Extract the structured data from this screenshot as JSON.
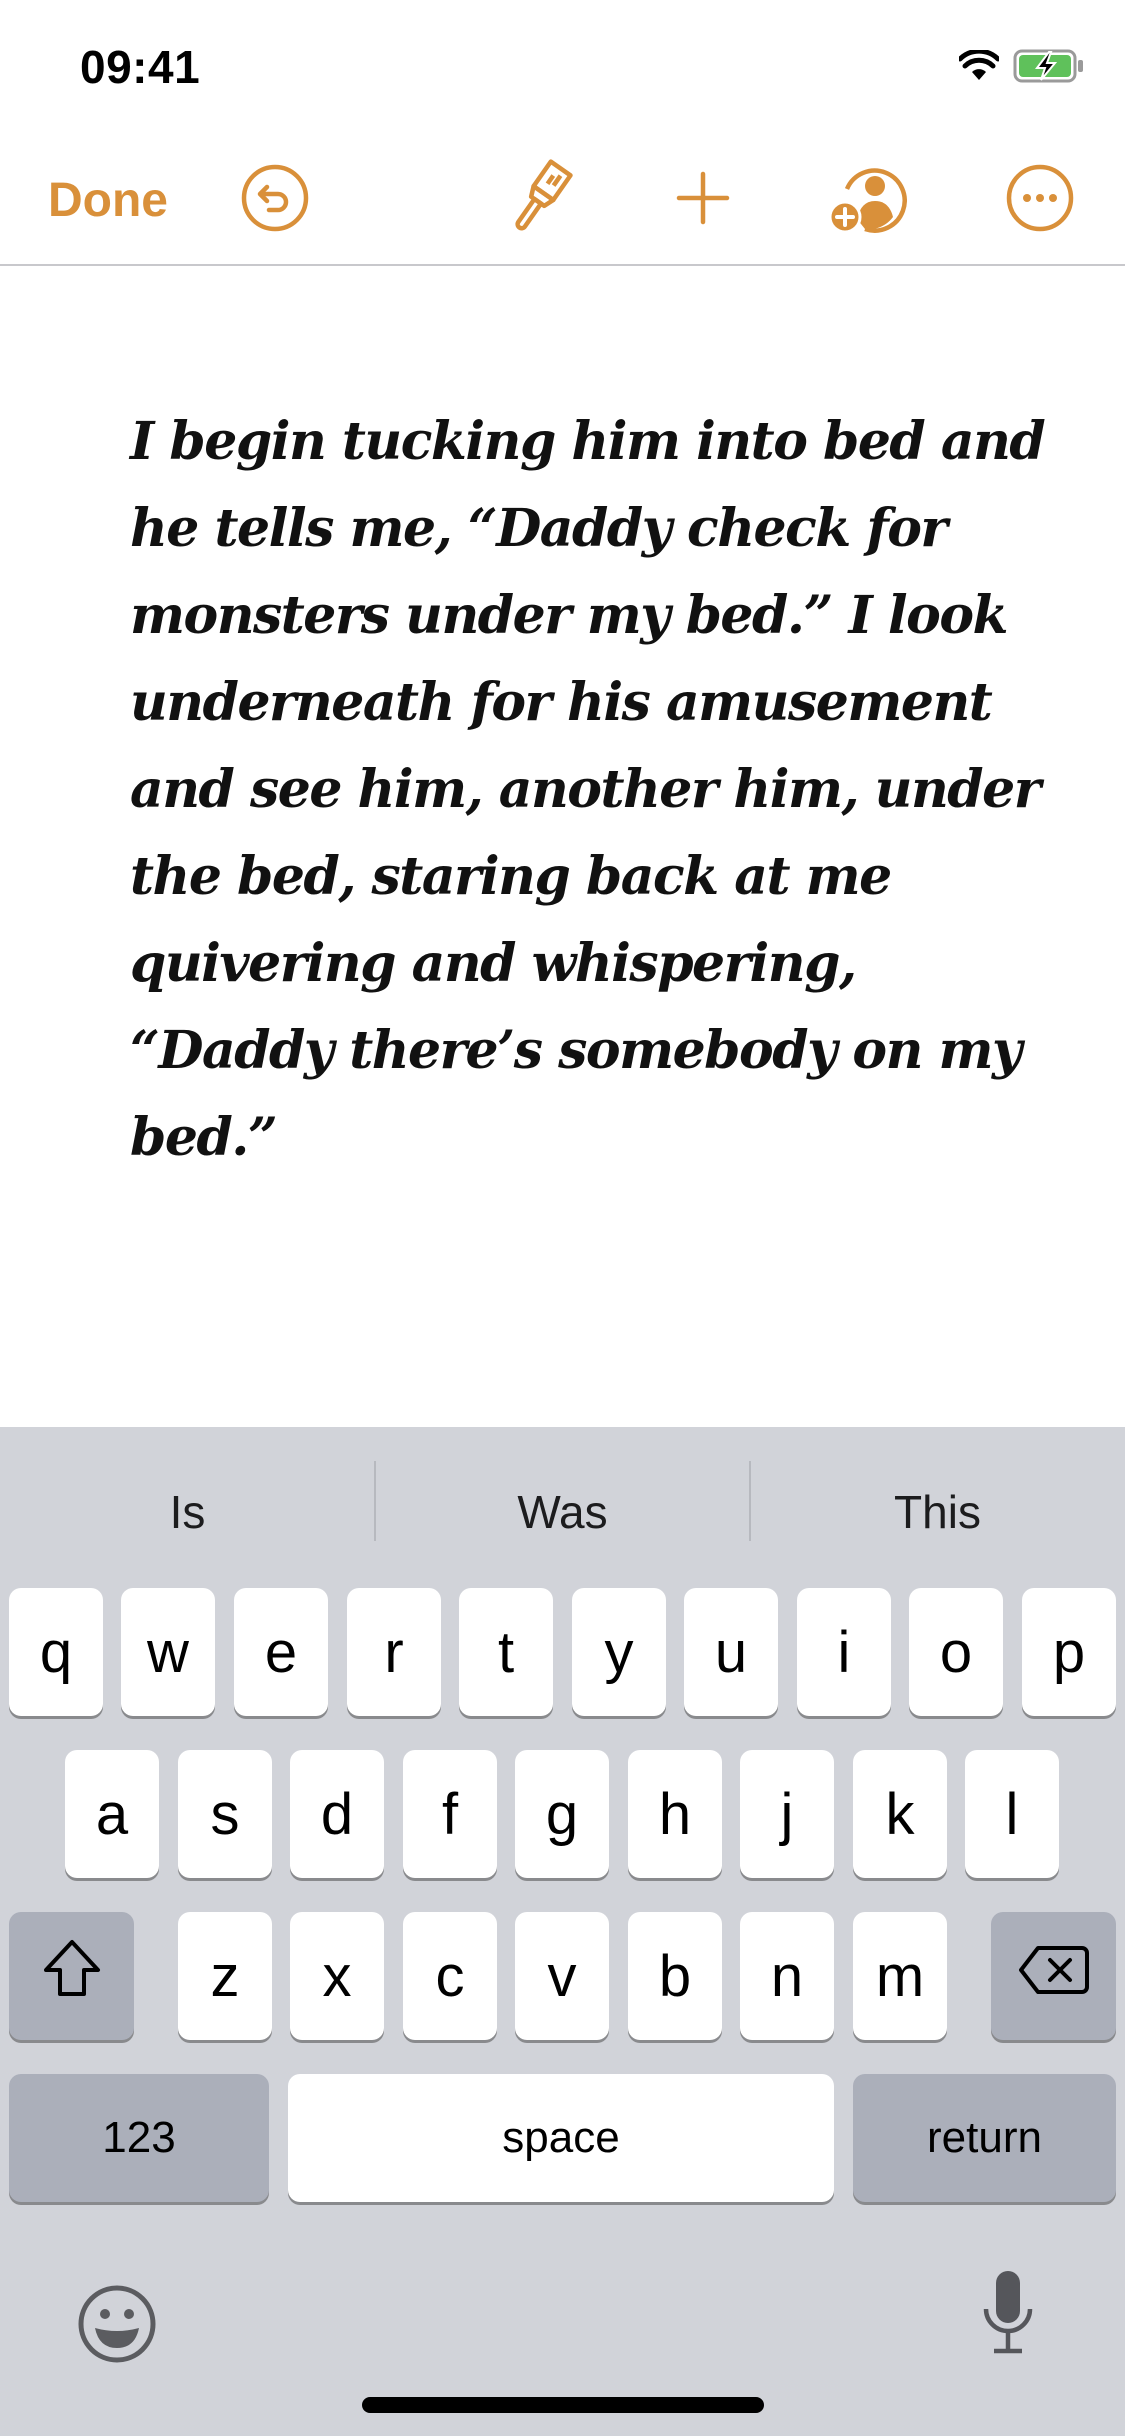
{
  "status_bar": {
    "time": "09:41",
    "icons": [
      "wifi-icon",
      "battery-charging-icon"
    ],
    "battery_color": "#5FC15B"
  },
  "toolbar": {
    "done_label": "Done",
    "accent_color": "#D9903A",
    "buttons": [
      "undo-icon",
      "format-brush-icon",
      "add-icon",
      "collaborate-icon",
      "more-icon"
    ]
  },
  "document": {
    "lines": [
      "I begin tucking him into bed and",
      "he tells me, “Daddy check for",
      "monsters under my bed.” I look",
      "underneath for his amusement",
      "and see him, another him, under",
      "the bed, staring back at me",
      "quivering and whispering,",
      "“Daddy there’s somebody on my",
      "bed.”"
    ]
  },
  "keyboard": {
    "suggestions": [
      "Is",
      "Was",
      "This"
    ],
    "row1": [
      "q",
      "w",
      "e",
      "r",
      "t",
      "y",
      "u",
      "i",
      "o",
      "p"
    ],
    "row2": [
      "a",
      "s",
      "d",
      "f",
      "g",
      "h",
      "j",
      "k",
      "l"
    ],
    "row3": [
      "z",
      "x",
      "c",
      "v",
      "b",
      "n",
      "m"
    ],
    "numbers_label": "123",
    "space_label": "space",
    "return_label": "return"
  }
}
